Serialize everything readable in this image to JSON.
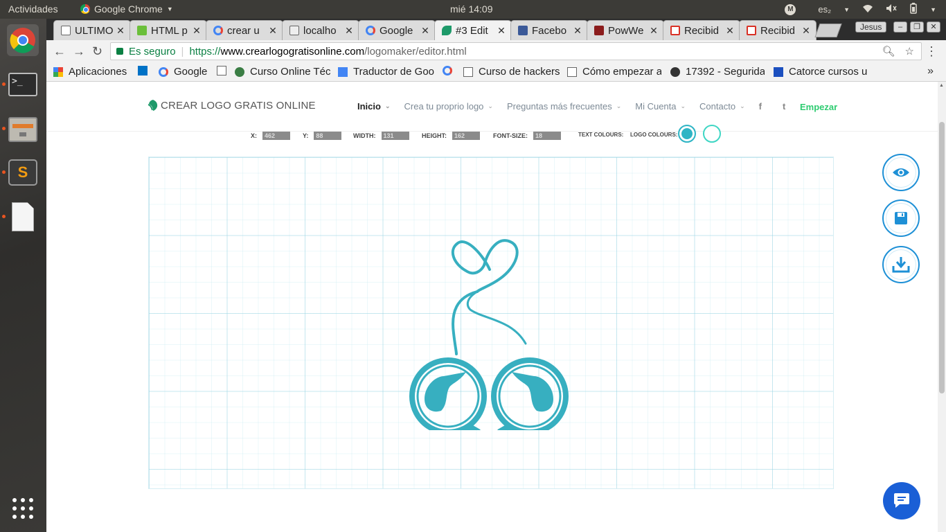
{
  "os": {
    "activities": "Actividades",
    "app_name": "Google Chrome",
    "clock": "mié 14:09",
    "keyboard": "es₂",
    "avatar_letter": "M"
  },
  "browser": {
    "tabs": [
      {
        "label": "ULTIMO",
        "icon": "doc-icon"
      },
      {
        "label": "HTML p",
        "icon": "html-icon"
      },
      {
        "label": "crear u",
        "icon": "google-icon"
      },
      {
        "label": "localho",
        "icon": "page-icon"
      },
      {
        "label": "Google",
        "icon": "google-icon"
      },
      {
        "label": "#3 Edit",
        "icon": "leaf-icon"
      },
      {
        "label": "Facebo",
        "icon": "facebook-icon"
      },
      {
        "label": "PowWe",
        "icon": "powwe-icon"
      },
      {
        "label": "Recibid",
        "icon": "gmail-icon"
      },
      {
        "label": "Recibid",
        "icon": "gmail-icon"
      }
    ],
    "user": "Jesus",
    "secure_label": "Es seguro",
    "url_scheme": "https://",
    "url_host": "www.crearlogogratisonline.com",
    "url_path": "/logomaker/editor.html",
    "bookmarks": [
      "Aplicaciones",
      "Google",
      "Curso Online Téc",
      "Traductor de Goo",
      "Curso de hackers",
      "Cómo empezar a",
      "17392 - Segurida",
      "Catorce cursos u"
    ],
    "bookmarks_more": "»"
  },
  "site": {
    "logo_text": "CREAR LOGO GRATIS ONLINE",
    "nav": [
      "Inicio",
      "Crea tu proprio logo",
      "Preguntas más frecuentes",
      "Mi Cuenta",
      "Contacto"
    ],
    "social": [
      "f",
      "t"
    ],
    "cta": "Empezar"
  },
  "editor": {
    "props": [
      {
        "label": "X:",
        "value": "462"
      },
      {
        "label": "Y:",
        "value": "88"
      },
      {
        "label": "WIDTH:",
        "value": "131"
      },
      {
        "label": "HEIGHT:",
        "value": "162"
      },
      {
        "label": "FONT-SIZE:",
        "value": "18"
      }
    ],
    "text_colours_label": "TEXT COLOURS:",
    "logo_colours_label": "LOGO COLOURS:",
    "colours": [
      "#2fb5c5",
      "#ffffff"
    ],
    "accent": "#1e90d6",
    "logo_color": "#37afc0",
    "chat_color": "#1a5fd6"
  }
}
